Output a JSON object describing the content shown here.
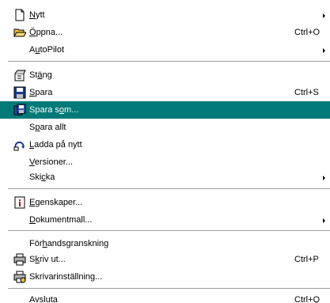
{
  "menu": {
    "items": {
      "nytt": {
        "pre": "",
        "u": "N",
        "post": "ytt",
        "icon": "new-document-icon",
        "submenu": true
      },
      "oppna": {
        "pre": "",
        "u": "Ö",
        "post": "ppna...",
        "shortcut": "Ctrl+O",
        "icon": "open-folder-icon"
      },
      "autopilot": {
        "pre": "A",
        "u": "u",
        "post": "toPilot",
        "submenu": true
      },
      "stang": {
        "pre": "St",
        "u": "ä",
        "post": "ng",
        "icon": "close-document-icon"
      },
      "spara": {
        "pre": "",
        "u": "S",
        "post": "para",
        "shortcut": "Ctrl+S",
        "icon": "floppy-disk-icon"
      },
      "spara_som": {
        "pre": "Spara s",
        "u": "o",
        "post": "m...",
        "icon": "save-as-icon",
        "highlighted": true
      },
      "spara_allt": {
        "pre": "S",
        "u": "p",
        "post": "ara allt"
      },
      "ladda": {
        "pre": "",
        "u": "L",
        "post": "adda på nytt",
        "icon": "reload-icon"
      },
      "versioner": {
        "pre": "",
        "u": "V",
        "post": "ersioner..."
      },
      "skicka": {
        "pre": "Ski",
        "u": "c",
        "post": "ka",
        "submenu": true
      },
      "egenskaper": {
        "pre": "",
        "u": "E",
        "post": "genskaper...",
        "icon": "properties-icon"
      },
      "dokumentmall": {
        "pre": "",
        "u": "D",
        "post": "okumentmall...",
        "submenu": true
      },
      "forhandsgranskning": {
        "pre": "För",
        "u": "h",
        "post": "andsgranskning"
      },
      "skriv_ut": {
        "pre": "S",
        "u": "k",
        "post": "riv ut...",
        "shortcut": "Ctrl+P",
        "icon": "printer-icon"
      },
      "skrivarinstallning": {
        "pre": "Skrivarinställning...",
        "u": "",
        "post": "",
        "icon": "printer-setup-icon"
      },
      "avsluta": {
        "pre": "Avsl",
        "u": "u",
        "post": "ta",
        "shortcut": "Ctrl+Q"
      }
    }
  },
  "colors": {
    "highlight": "#007a78",
    "highlight_text": "#ffffff",
    "separator": "#9e9e9e"
  }
}
